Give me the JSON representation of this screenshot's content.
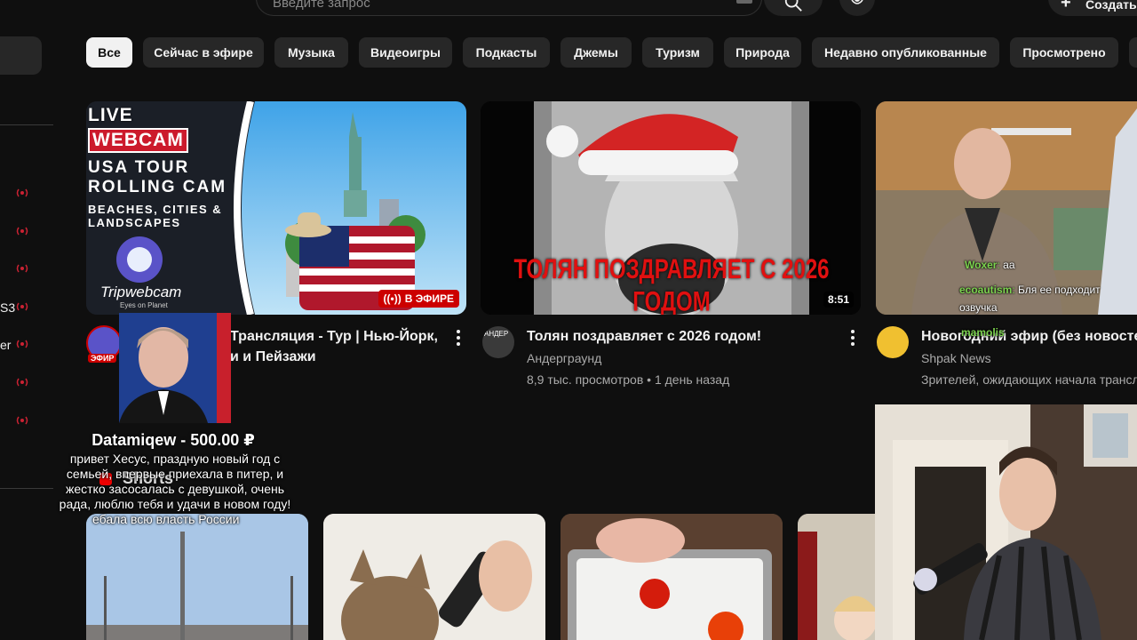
{
  "search": {
    "placeholder": "Введите запрос"
  },
  "header": {
    "create_label": "Создать"
  },
  "sidebar": {
    "partial_items": [
      "S3",
      "er"
    ]
  },
  "chips": [
    "Все",
    "Сейчас в эфире",
    "Музыка",
    "Видеоигры",
    "Подкасты",
    "Джемы",
    "Туризм",
    "Природа",
    "Недавно опубликованные",
    "Просмотрено"
  ],
  "videos": [
    {
      "thumb_title_lines": [
        "LIVE",
        "WEBCAM",
        "USA TOUR",
        "ROLLING CAM",
        "BEACHES, CITIES &",
        "LANDSCAPES"
      ],
      "brand": "Tripwebcam",
      "brand_tag": "Eyes on Planet",
      "badge": "В ЭФИРЕ",
      "title_line1": "Трансляция - Тур | Нью-Йорк,",
      "title_line2": "и и Пейзажи",
      "avatar_badge": "ЭФИР"
    },
    {
      "thumb_caption": "ТОЛЯН ПОЗДРАВЛЯЕТ С 2026 ГОДОМ",
      "duration": "8:51",
      "title": "Толян поздравляет с 2026 годом!",
      "channel": "Андерграунд",
      "avatar_text": "АНДЕР",
      "meta": "8,9 тыс. просмотров • 1 день назад"
    },
    {
      "title": "Новогодний эфир (без новостей)",
      "channel": "Shpak News",
      "meta": "Зрителей, ожидающих начала трансляции"
    }
  ],
  "chat": [
    {
      "user": "Woxer",
      "text": "аа"
    },
    {
      "user": "ecoautism",
      "text": "Бля ее подходит"
    },
    {
      "user": "",
      "text": "озвучка"
    },
    {
      "user": "mamolis",
      "text": ""
    }
  ],
  "donation": {
    "title": "Datamiqew - 500.00 ₽",
    "message": "привет Хесус, праздную новый год с семьей, впервые приехала в питер, и жестко засосалась с девушкой, очень рада, люблю тебя и удачи в новом году!",
    "extra": "ебала всю власть России"
  },
  "shorts": {
    "label": "Shorts"
  },
  "colors": {
    "background": "#0f0f0f",
    "chip": "#272727",
    "chip_active": "#f1f1f1",
    "live_red": "#cc0000",
    "meta": "#aaaaaa",
    "chat_green": "#7cd34f"
  }
}
